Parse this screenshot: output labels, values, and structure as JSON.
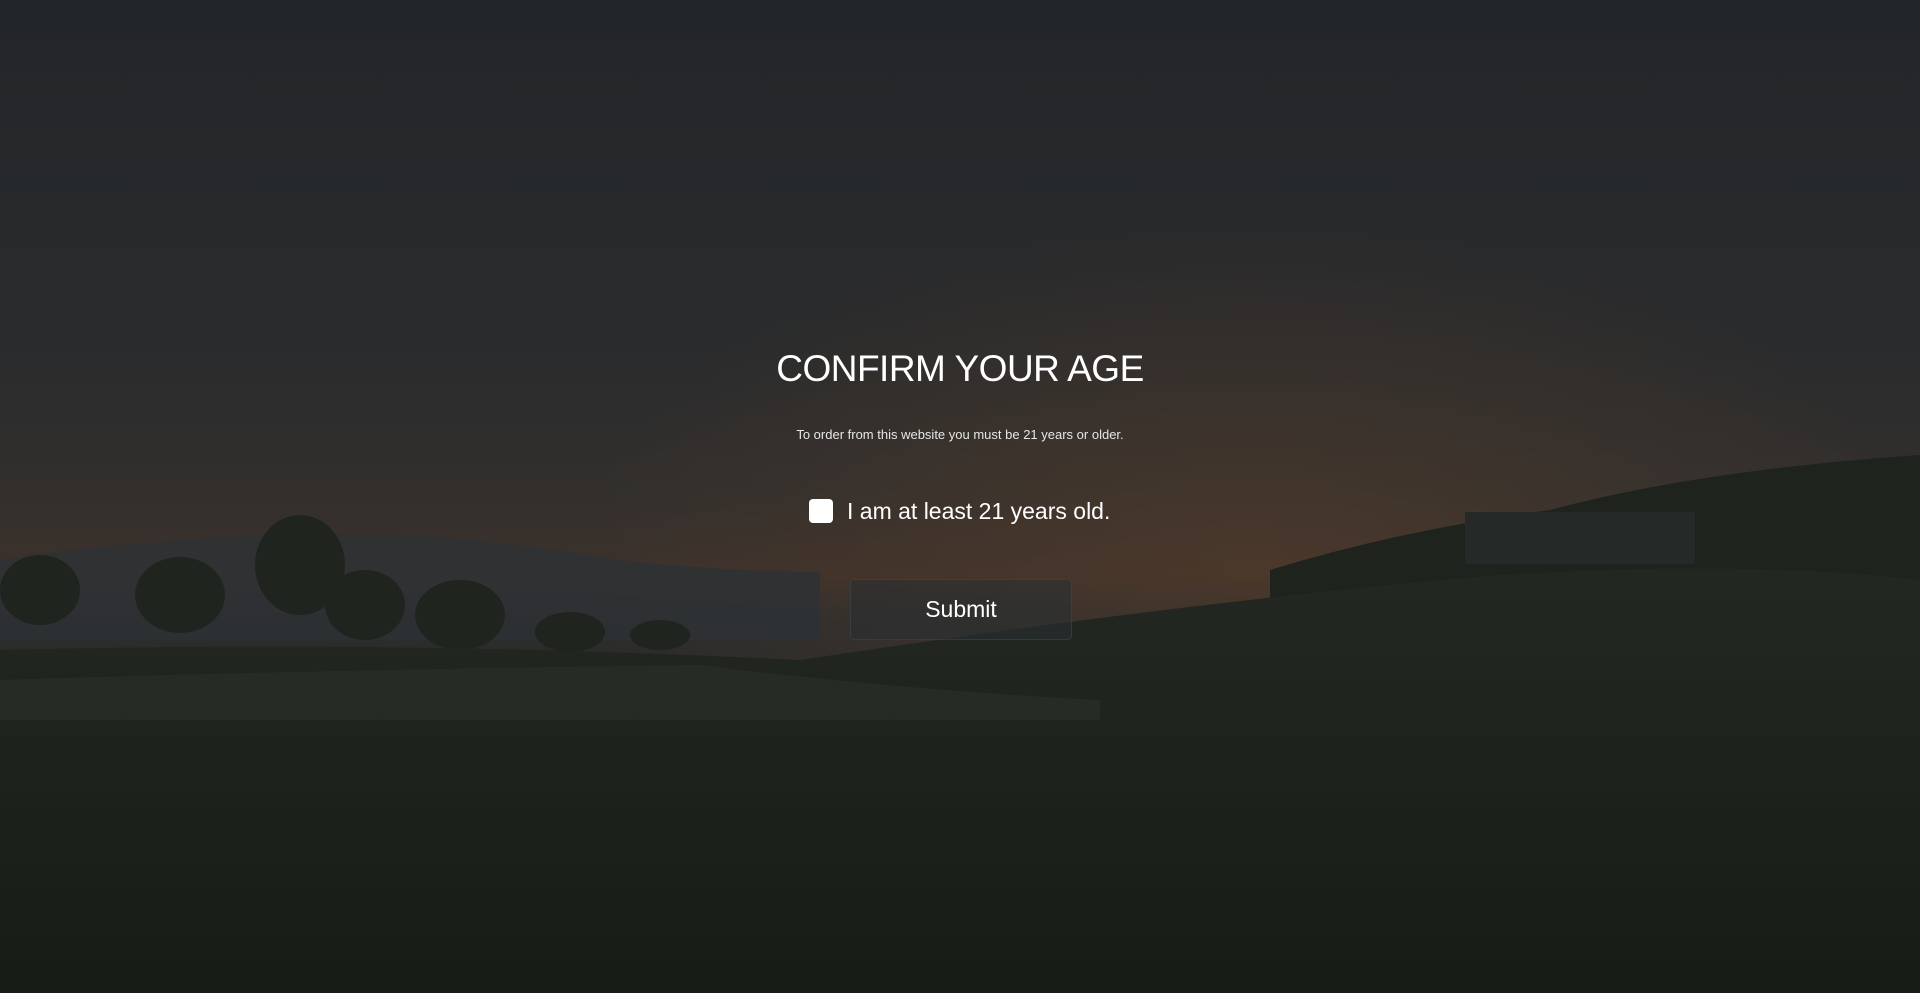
{
  "age_gate": {
    "title": "CONFIRM YOUR AGE",
    "subtitle": "To order from this website you must be 21 years or older.",
    "checkbox_label": "I am at least 21 years old.",
    "checkbox_checked": false,
    "submit_label": "Submit"
  },
  "background": {
    "description_icon": "landscape-background",
    "sky_top": "#2b2e33",
    "sky_mid": "#3a3838",
    "horizon_glow": "#5a3e34",
    "field": "#1a1f18"
  }
}
